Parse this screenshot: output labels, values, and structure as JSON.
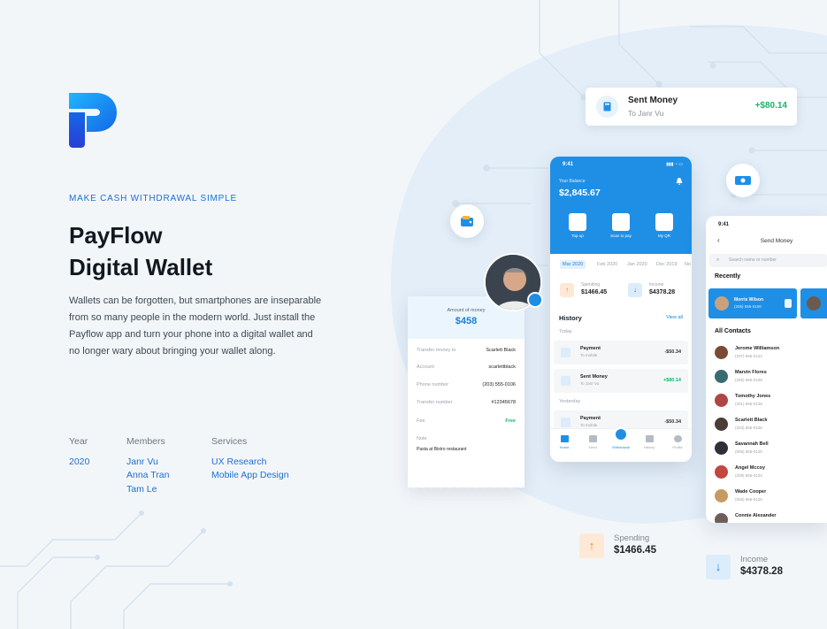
{
  "brand": {
    "kicker": "MAKE CASH WITHDRAWAL SIMPLE",
    "title_line1": "PayFlow",
    "title_line2": "Digital Wallet",
    "description": "Wallets can be forgotten, but smartphones are inseparable from so many people in the modern world. Just install the Payflow app and turn your phone into a digital wallet and no longer wary about bringing your wallet along.",
    "logo_colors": [
      "#1fb6ff",
      "#1467e6",
      "#2a3fd6"
    ]
  },
  "meta": {
    "year": {
      "label": "Year",
      "values": [
        "2020"
      ]
    },
    "members": {
      "label": "Members",
      "values": [
        "Janr Vu",
        "Anna Tran",
        "Tam Le"
      ]
    },
    "services": {
      "label": "Services",
      "values": [
        "UX Research",
        "Mobile App Design"
      ]
    }
  },
  "sent_card": {
    "title": "Sent Money",
    "subtitle": "To Janr Vu",
    "amount": "+$80.14",
    "icon": "wallet-icon"
  },
  "phone_main": {
    "time": "9:41",
    "balance_label": "Your Balance",
    "balance": "$2,845.67",
    "actions": [
      {
        "label": "Top up",
        "icon": "wallet-icon"
      },
      {
        "label": "Scan to pay",
        "icon": "scan-icon"
      },
      {
        "label": "My QR",
        "icon": "barcode-icon"
      }
    ],
    "months": [
      "Mar 2020",
      "Feb 2020",
      "Jan 2020",
      "Dec 2019",
      "No"
    ],
    "spending": {
      "label": "Spending",
      "value": "$1466.45"
    },
    "income": {
      "label": "Income",
      "value": "$4378.28"
    },
    "history_title": "History",
    "view_all": "View all",
    "today_label": "Today",
    "yesterday_label": "Yesterday",
    "transactions": [
      {
        "name": "Payment",
        "sub": "To mobile",
        "amount": "-$50.34",
        "positive": false
      },
      {
        "name": "Sent Money",
        "sub": "To Janr Vu",
        "amount": "+$80.14",
        "positive": true
      },
      {
        "name": "Payment",
        "sub": "To mobile",
        "amount": "-$50.34",
        "positive": false
      }
    ],
    "nav": [
      "Home",
      "Send",
      "Withdrawal",
      "History",
      "Profile"
    ]
  },
  "receipt": {
    "amount_label": "Amount of money",
    "amount": "$458",
    "rows": [
      {
        "key": "Transfer money to",
        "value": "Scarlett Black"
      },
      {
        "key": "Account",
        "value": "scarlettblack"
      },
      {
        "key": "Phone number",
        "value": "(203) 555-0106"
      },
      {
        "key": "Transfer number",
        "value": "#12345678"
      },
      {
        "key": "Fee",
        "value": "Free"
      }
    ],
    "note_label": "Note",
    "note": "Pasta at Bistro restaurant"
  },
  "phone_send": {
    "time": "9:41",
    "title": "Send Money",
    "search_placeholder": "Search name or number",
    "recently_label": "Recently",
    "recent_contact": {
      "name": "Morris Wilson",
      "phone": "(205) 555-0100"
    },
    "all_contacts_label": "All Contacts",
    "contacts": [
      {
        "name": "Jerome Williamson",
        "phone": "(207) 555-0123",
        "color": "#7b4a35"
      },
      {
        "name": "Marvin Flores",
        "phone": "(205) 555-0108",
        "color": "#3a6b70"
      },
      {
        "name": "Tomothy Jones",
        "phone": "(201) 555-0128",
        "color": "#b04545"
      },
      {
        "name": "Scarlett Black",
        "phone": "(203) 555-0106",
        "color": "#4b3d35"
      },
      {
        "name": "Savannah Bell",
        "phone": "(505) 555-0125",
        "color": "#2f2f3a"
      },
      {
        "name": "Angel Mccoy",
        "phone": "(209) 555-0104",
        "color": "#c2473f"
      },
      {
        "name": "Wade Cooper",
        "phone": "(505) 555-0125",
        "color": "#c79a62"
      },
      {
        "name": "Connie Alexander",
        "phone": "",
        "color": "#6d5f58"
      }
    ]
  },
  "bottom_stats": {
    "spending": {
      "label": "Spending",
      "value": "$1466.45"
    },
    "income": {
      "label": "Income",
      "value": "$4378.28"
    }
  },
  "colors": {
    "primary": "#1f8fe6",
    "positive": "#19b46b",
    "spending_bg": "#fde9d6",
    "spending_fg": "#e08a2e",
    "income_bg": "#dcecfb",
    "income_fg": "#1a7fd9"
  }
}
